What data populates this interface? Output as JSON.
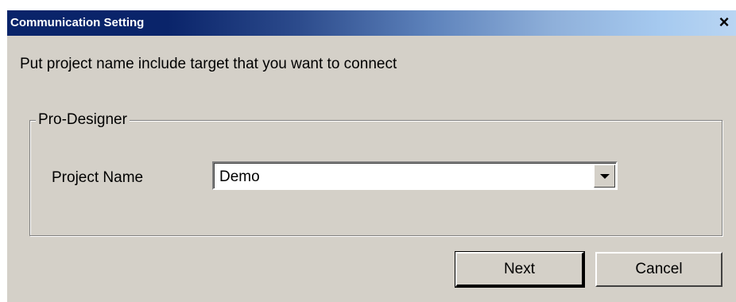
{
  "dialog": {
    "title": "Communication Setting",
    "close_glyph": "×",
    "prompt": "Put project name include target that you want to connect",
    "group": {
      "label": "Pro-Designer",
      "field_label": "Project Name",
      "project_value": "Demo"
    },
    "buttons": {
      "next": "Next",
      "cancel": "Cancel"
    }
  },
  "colors": {
    "face": "#d4d0c8",
    "title_start": "#0a246a",
    "title_end": "#a6caf0"
  },
  "icons": [
    "close-icon",
    "dropdown-arrow-icon"
  ]
}
